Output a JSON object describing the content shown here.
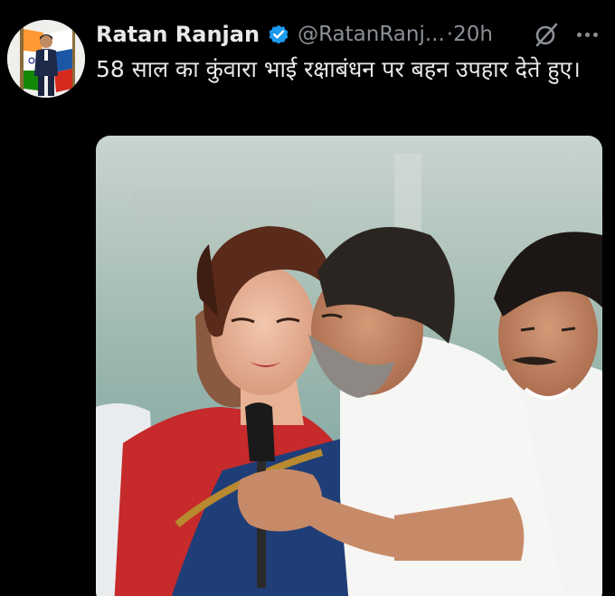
{
  "author": {
    "name": "Ratan Ranjan",
    "handle": "@RatanRanj...",
    "separator": "·",
    "time": "20h",
    "verified": true,
    "verified_color": "#1d9bf0"
  },
  "tweet": {
    "text": "58 साल का कुंवारा भाई रक्षाबंधन पर बहन उपहार देते हुए।"
  },
  "icons": {
    "avatar": "profile-photo-with-flags",
    "verified": "verified-badge-icon",
    "grok": "grok-icon",
    "more": "more-options-icon"
  },
  "media": {
    "type": "photo"
  },
  "colors": {
    "background": "#000000",
    "text_primary": "#e7e9ea",
    "text_secondary": "#8b9096"
  }
}
